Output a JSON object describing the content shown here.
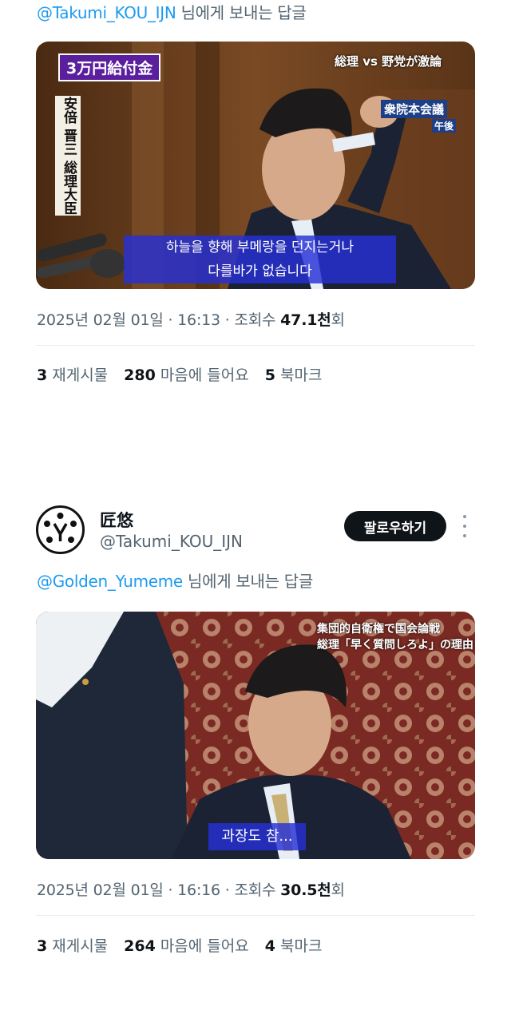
{
  "post1": {
    "reply_mention": "@Takumi_KOU_IJN",
    "reply_suffix": " 님에게 보내는 답글",
    "media": {
      "tag_top_left": "3万円給付金",
      "tag_top_right": "総理 vs 野党が激論",
      "tag_side": "衆院本会議",
      "tag_side_small": "午後",
      "vertical_name": "安倍 晋三 総理大臣",
      "subtitle_line1": "하늘을 향해 부메랑을 던지는거나",
      "subtitle_line2": "다를바가 없습니다"
    },
    "date": "2025년 02월 01일",
    "time": "16:13",
    "views_label": "조회수",
    "views_value": "47.1천",
    "views_suffix": "회",
    "reposts_count": "3",
    "reposts_label": "재게시물",
    "likes_count": "280",
    "likes_label": "마음에 들어요",
    "bookmarks_count": "5",
    "bookmarks_label": "북마크"
  },
  "post2": {
    "author_name": "匠悠",
    "author_handle": "@Takumi_KOU_IJN",
    "follow_label": "팔로우하기",
    "reply_mention": "@Golden_Yumeme",
    "reply_suffix": " 님에게 보내는 답글",
    "media": {
      "tag_line1": "集団的自衛権で国会論戦",
      "tag_line2": "総理「早く質問しろよ」の理由",
      "subtitle": "과장도 참..."
    },
    "date": "2025년 02월 01일",
    "time": "16:16",
    "views_label": "조회수",
    "views_value": "30.5천",
    "views_suffix": "회",
    "reposts_count": "3",
    "reposts_label": "재게시물",
    "likes_count": "264",
    "likes_label": "마음에 들어요",
    "bookmarks_count": "4",
    "bookmarks_label": "북마크"
  }
}
